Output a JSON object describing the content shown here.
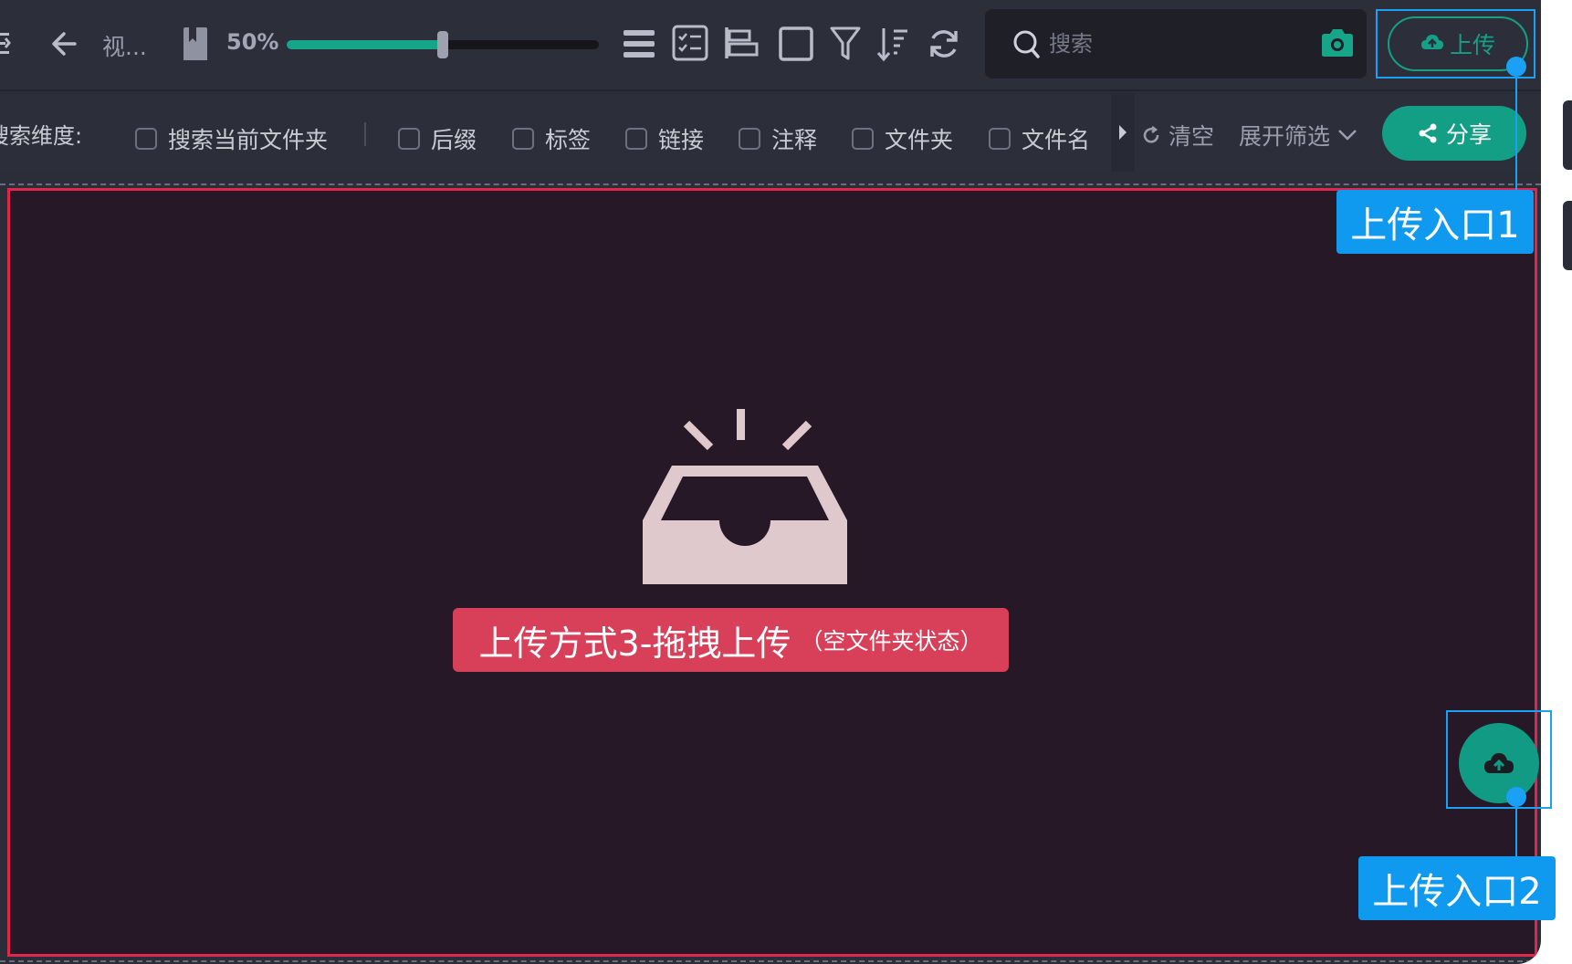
{
  "toolbar": {
    "folder_title": "视...",
    "zoom_label": "50%",
    "zoom_value": 0.5,
    "upload_label": "上传"
  },
  "search": {
    "placeholder": "搜索"
  },
  "filter": {
    "label": "搜索维度:",
    "options": [
      {
        "label": "搜索当前文件夹",
        "checked": false
      },
      {
        "label": "后缀",
        "checked": false
      },
      {
        "label": "标签",
        "checked": false
      },
      {
        "label": "链接",
        "checked": false
      },
      {
        "label": "注释",
        "checked": false
      },
      {
        "label": "文件夹",
        "checked": false
      },
      {
        "label": "文件名",
        "checked": false
      }
    ],
    "clear_label": "清空",
    "expand_label": "展开筛选",
    "share_label": "分享"
  },
  "drop_area": {
    "title": "上传方式3-拖拽上传",
    "subtitle": "（空文件夹状态）"
  },
  "annotations": {
    "entry1": "上传入口1",
    "entry2": "上传入口2"
  },
  "colors": {
    "accent": "#17a58a",
    "annotation_blue": "#1aa0f5",
    "drop_border": "#e0274b",
    "drop_label": "#d8405a"
  }
}
